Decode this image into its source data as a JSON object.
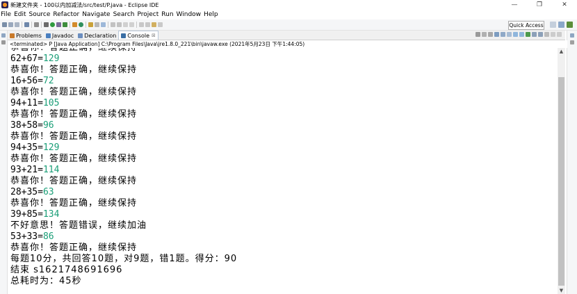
{
  "window": {
    "title": "新建文件夹 - 100以内加减法/src/test/P.java - Eclipse IDE",
    "minimize": "—",
    "maximize": "❐",
    "close": "✕"
  },
  "menu": [
    "File",
    "Edit",
    "Source",
    "Refactor",
    "Navigate",
    "Search",
    "Project",
    "Run",
    "Window",
    "Help"
  ],
  "toolbar": {
    "quick_access": "Quick Access"
  },
  "tabs": [
    {
      "label": "Problems",
      "icon": "problems-icon",
      "color": "#c97a2a"
    },
    {
      "label": "Javadoc",
      "icon": "javadoc-icon",
      "color": "#4a7fbf"
    },
    {
      "label": "Declaration",
      "icon": "declaration-icon",
      "color": "#6c8ebf"
    },
    {
      "label": "Console",
      "icon": "console-icon",
      "color": "#3a6ea5",
      "close": "⊠"
    }
  ],
  "console": {
    "status": "<terminated> P [Java Application] C:\\Program Files\\Java\\jre1.8.0_221\\bin\\javaw.exe (2021年5月23日 下午1:44:05)",
    "lines": [
      {
        "text": "恭喜你！答题正确，继续保持"
      },
      {
        "text": "62+67=",
        "input": "129"
      },
      {
        "text": "恭喜你！答题正确，继续保持"
      },
      {
        "text": "16+56=",
        "input": "72"
      },
      {
        "text": "恭喜你！答题正确，继续保持"
      },
      {
        "text": "94+11=",
        "input": "105"
      },
      {
        "text": "恭喜你！答题正确，继续保持"
      },
      {
        "text": "38+58=",
        "input": "96"
      },
      {
        "text": "恭喜你！答题正确，继续保持"
      },
      {
        "text": "94+35=",
        "input": "129"
      },
      {
        "text": "恭喜你！答题正确，继续保持"
      },
      {
        "text": "93+21=",
        "input": "114"
      },
      {
        "text": "恭喜你！答题正确，继续保持"
      },
      {
        "text": "28+35=",
        "input": "63"
      },
      {
        "text": "恭喜你！答题正确，继续保持"
      },
      {
        "text": "39+85=",
        "input": "134"
      },
      {
        "text": "不好意思！答题错误，继续加油"
      },
      {
        "text": "53+33=",
        "input": "86"
      },
      {
        "text": "恭喜你！答题正确，继续保持"
      },
      {
        "text": "每题10分，共回答10题，对9题，错1题。得分：90"
      },
      {
        "text": "结束 s1621748691696"
      },
      {
        "text": "总耗时为：45秒"
      }
    ],
    "input_color": "#1a9e77"
  },
  "scroll": {
    "up": "▲",
    "down": "▼"
  }
}
